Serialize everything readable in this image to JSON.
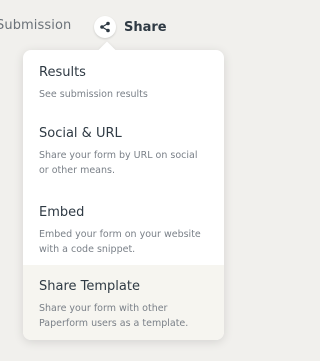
{
  "header": {
    "submission_label": "Submission",
    "share_label": "Share"
  },
  "share_menu": {
    "items": [
      {
        "title": "Results",
        "description": "See submission results"
      },
      {
        "title": "Social & URL",
        "description": "Share your form by URL on social or other means."
      },
      {
        "title": "Embed",
        "description": "Embed your form on your website with a code snippet."
      },
      {
        "title": "Share Template",
        "description": "Share your form with other Paperform users as a template."
      }
    ]
  },
  "colors": {
    "background": "#f1f0ed",
    "menu_background": "#ffffff",
    "active_item_background": "#f6f5f0",
    "text": "#2f3a44",
    "muted_text": "#7a8088"
  }
}
